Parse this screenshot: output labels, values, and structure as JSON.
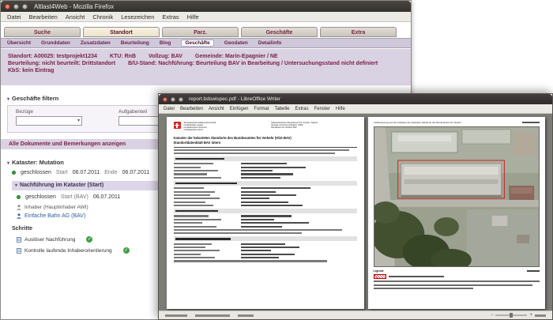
{
  "firefox": {
    "window_title": "Altlast4Web - Mozilla Firefox",
    "menu": [
      "Datei",
      "Bearbeiten",
      "Ansicht",
      "Chronik",
      "Lesezeichen",
      "Extras",
      "Hilfe"
    ],
    "tabs": [
      "Suche",
      "Standort",
      "Parz.",
      "Geschäfte",
      "Extra"
    ],
    "subtabs": [
      "Übersicht",
      "Grunddaten",
      "Zusatzdaten",
      "Beurteilung",
      "Blog",
      "Geschäfte",
      "Geodaten",
      "Detailinfo"
    ],
    "info_line1": [
      "Standort: A00025: testprojekt1234",
      "KTU: RnB",
      "Vollzug: BAV",
      "Gemeinde: Marin-Epagnier / NE"
    ],
    "info_line2": [
      "Beurteilung: nicht beurteilt: Drittstandort",
      "B/U-Stand: Nachführung: Beurteilung BAV in Bearbeitung / Untersuchungsstand nicht definiert"
    ],
    "info_line3": [
      "KbS: kein Eintrag"
    ],
    "filter_header": "Geschäfte filtern",
    "filter_fields": {
      "bezuege": "Bezüge",
      "aufgabenteil": "Aufgabenteil"
    },
    "docs_link": "Alle Dokumente und Bemerkungen anzeigen",
    "kataster_header": "Kataster: Mutation",
    "kataster_status": "geschlossen",
    "kataster_start_label": "Start",
    "kataster_start": "06.07.2011",
    "kataster_end_label": "Ende",
    "kataster_end": "06.07.2011",
    "nachfuehrung_header": "Nachführung im Kataster (Start)",
    "nf_status": "geschlossen",
    "nf_start_label": "Start (BAV)",
    "nf_start": "06.07.2011",
    "inhaber_label": "Inhaber (Hauptinhaber AWI)",
    "inhaber_value": "Einfache Bahn AG (BAV)",
    "schritte_header": "Schritte",
    "schritte": [
      "Auslöser Nachführung",
      "Kontrolle laufende Inhaberorientierung"
    ]
  },
  "pdf": {
    "window_title": "report.bdswispec.pdf - LibreOffice Writer",
    "menu": [
      "Datei",
      "Bearbeiten",
      "Ansicht",
      "Einfügen",
      "Format",
      "Tabelle",
      "Extras",
      "Fenster",
      "Hilfe"
    ],
    "left_page": {
      "confederation_lines": [
        "Schweizerische Eidgenossenschaft",
        "Confédération suisse",
        "Confederazione Svizzera",
        "Confederaziun svizra"
      ],
      "department_lines": [
        "Eidgenössisches Departement für Umwelt, Verkehr,",
        "Energie und Kommunikation UVEK",
        "Bundesamt für Verkehr BAV"
      ],
      "title_line1": "Kataster der belasteten Standorte des Bundesamtes für Verkehr (KbS BAV)",
      "title_line2": "Standortdatenblatt BAV intern"
    },
    "right_page": {
      "title": "Katasterauszug aus dem Kataster der belasteten Standorte des Bundesamtes für Verkehr",
      "legend_label": "Legende"
    }
  },
  "colors": {
    "accent_maroon": "#7a1e46",
    "lavender": "#d9d2e2",
    "check_green": "#43a047",
    "swiss_red": "#d52b1e"
  }
}
